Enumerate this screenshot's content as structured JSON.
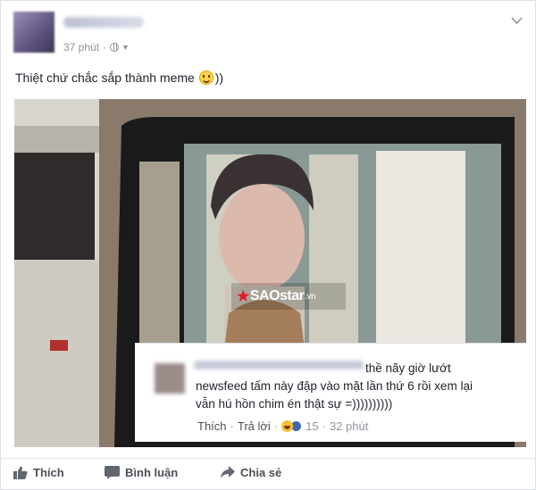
{
  "post": {
    "time": "37 phút",
    "dot": "·",
    "caption": "Thiệt chứ chắc sắp thành meme",
    "caption_tail": "))"
  },
  "photo": {
    "watermark_brand": "SAOstar",
    "watermark_domain": ".vn"
  },
  "comment": {
    "text": "thề nãy giờ lướt newsfeed tấm này đập vào mặt lần thứ 6 rồi xem lại vẫn hú hồn chim én thật sự =))))))))))",
    "like_label": "Thích",
    "reply_label": "Trả lời",
    "reaction_count": "15",
    "time": "32 phút",
    "dot": "·"
  },
  "actions": {
    "like": "Thích",
    "comment": "Bình luận",
    "share": "Chia sẻ"
  },
  "colors": {
    "meta_gray": "#90949c",
    "action_gray": "#4b4f56",
    "like_blue": "#4267b2"
  }
}
